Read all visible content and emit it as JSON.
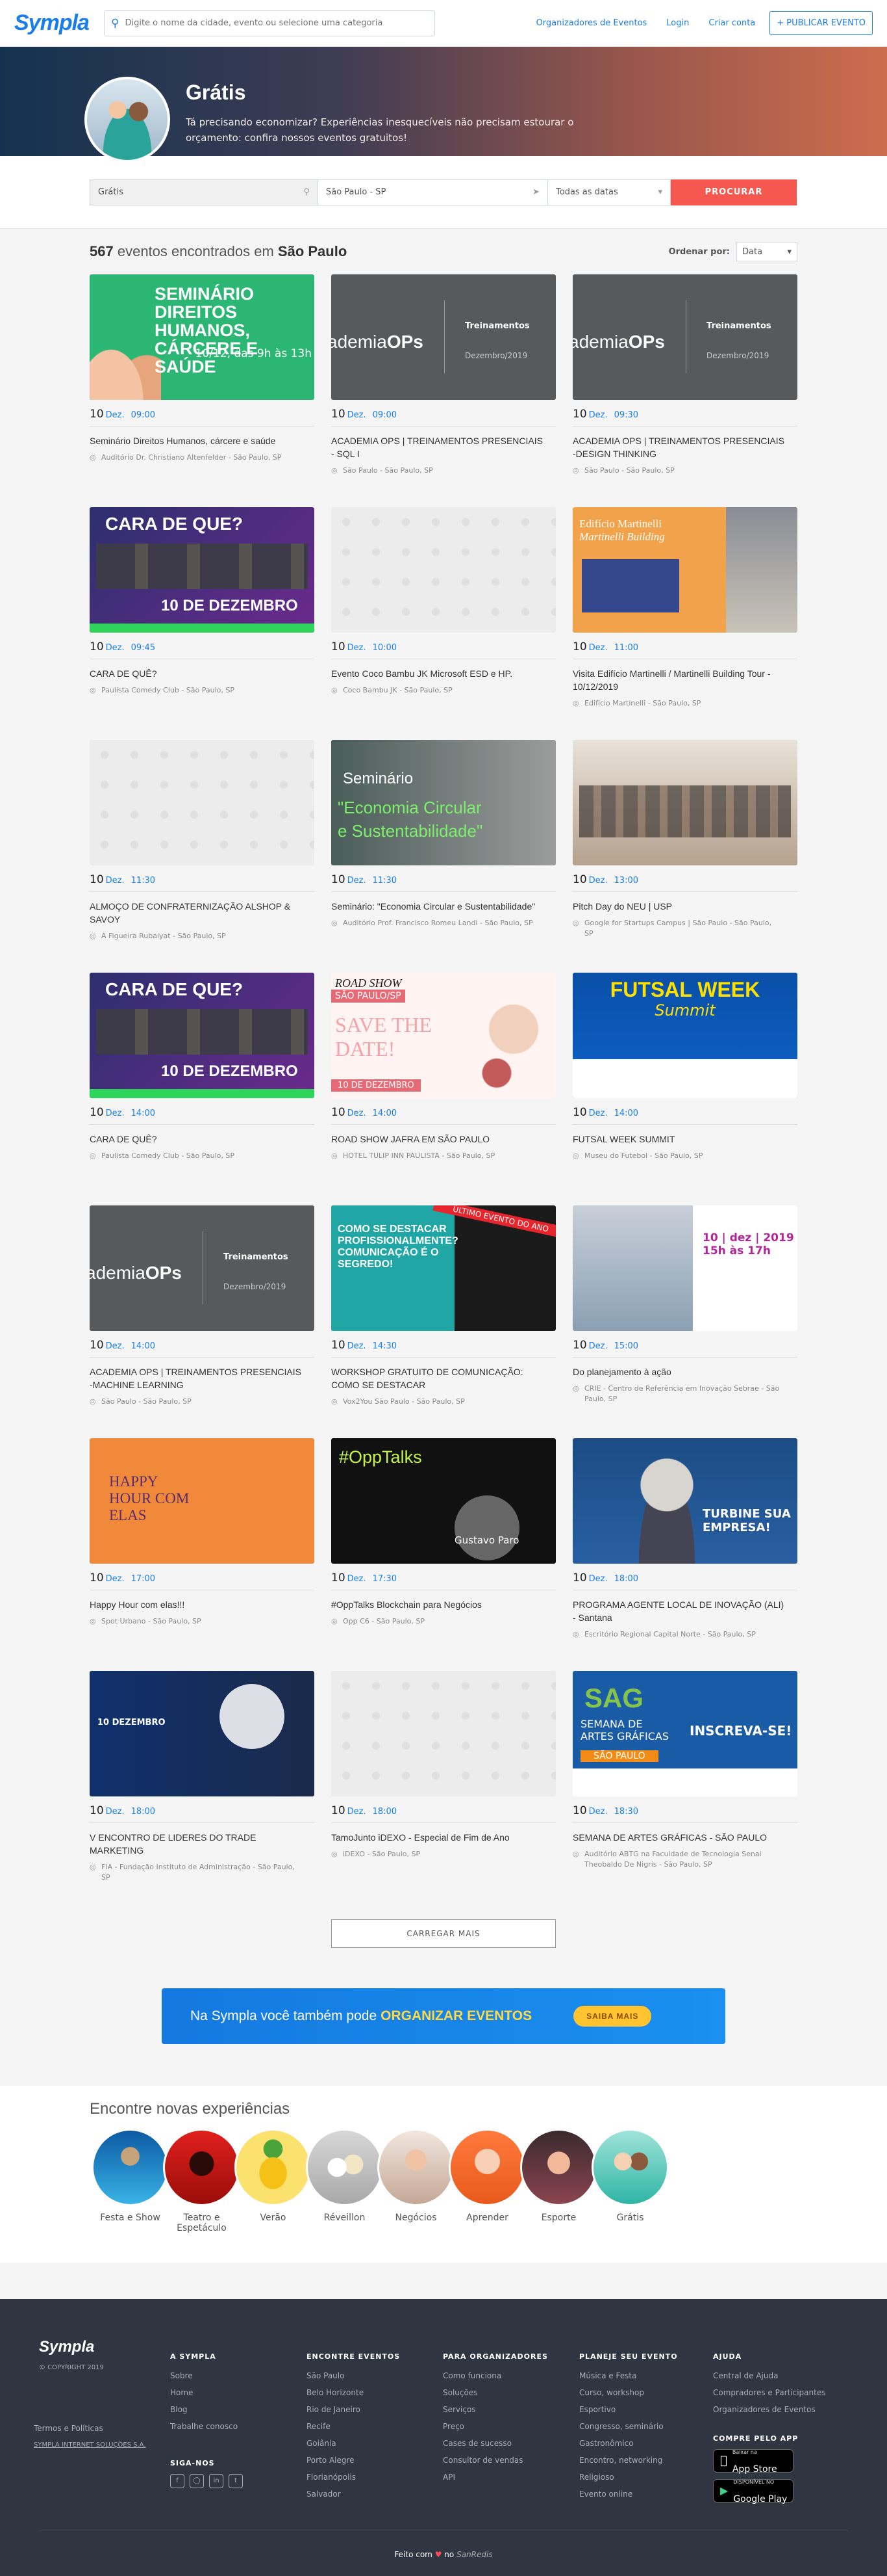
{
  "header": {
    "logo": "Sympla",
    "search_placeholder": "Digite o nome da cidade, evento ou selecione uma categoria",
    "nav": [
      "Organizadores de Eventos",
      "Login",
      "Criar conta"
    ],
    "publish": "+ PUBLICAR EVENTO"
  },
  "hero": {
    "title": "Grátis",
    "subtitle": "Tá precisando economizar? Experiências inesquecíveis não precisam estourar o orçamento: confira nossos eventos gratuitos!"
  },
  "filters": {
    "category": "Grátis",
    "city": "São Paulo - SP",
    "date": "Todas as datas",
    "search": "PROCURAR"
  },
  "results": {
    "count": "567",
    "text": "eventos encontrados em",
    "city": "São Paulo",
    "sort_label": "Ordenar por:",
    "sort_value": "Data"
  },
  "events": [
    {
      "day": "10",
      "month": "Dez.",
      "time": "09:00",
      "title": "Seminário Direitos Humanos, cárcere e saúde",
      "loc": "Auditório Dr. Christiano Altenfelder - São Paulo, SP",
      "img": "seminario"
    },
    {
      "day": "10",
      "month": "Dez.",
      "time": "09:00",
      "title": "ACADEMIA OPS | TREINAMENTOS PRESENCIAIS - SQL I",
      "loc": "São Paulo - São Paulo, SP",
      "img": "academia"
    },
    {
      "day": "10",
      "month": "Dez.",
      "time": "09:30",
      "title": "ACADEMIA OPS | TREINAMENTOS PRESENCIAIS -DESIGN THINKING",
      "loc": "São Paulo - São Paulo, SP",
      "img": "academia"
    },
    {
      "day": "10",
      "month": "Dez.",
      "time": "09:45",
      "title": "CARA DE QUÊ?",
      "loc": "Paulista Comedy Club - São Paulo, SP",
      "img": "cara"
    },
    {
      "day": "10",
      "month": "Dez.",
      "time": "10:00",
      "title": "Evento Coco Bambu JK Microsoft ESD e HP.",
      "loc": "Coco Bambu JK - São Paulo, SP",
      "img": "blank"
    },
    {
      "day": "10",
      "month": "Dez.",
      "time": "11:00",
      "title": "Visita Edifício Martinelli / Martinelli Building Tour - 10/12/2019",
      "loc": "Edifício Martinelli - São Paulo, SP",
      "img": "martinelli"
    },
    {
      "day": "10",
      "month": "Dez.",
      "time": "11:30",
      "title": "ALMOÇO DE CONFRATERNIZAÇÃO ALSHOP & SAVOY",
      "loc": "A Figueira Rubaiyat - São Paulo, SP",
      "img": "blank"
    },
    {
      "day": "10",
      "month": "Dez.",
      "time": "11:30",
      "title": "Seminário: \"Economia Circular e Sustentabilidade\"",
      "loc": "Auditório Prof. Francisco Romeu Landi - São Paulo, SP",
      "img": "economia"
    },
    {
      "day": "10",
      "month": "Dez.",
      "time": "13:00",
      "title": "Pitch Day do NEU | USP",
      "loc": "Google for Startups Campus | São Paulo - São Paulo, SP",
      "img": "pitch"
    },
    {
      "day": "10",
      "month": "Dez.",
      "time": "14:00",
      "title": "CARA DE QUÊ?",
      "loc": "Paulista Comedy Club - São Paulo, SP",
      "img": "cara"
    },
    {
      "day": "10",
      "month": "Dez.",
      "time": "14:00",
      "title": "ROAD SHOW JAFRA EM SÃO PAULO",
      "loc": "HOTEL TULIP INN PAULISTA - São Paulo, SP",
      "img": "roadshow"
    },
    {
      "day": "10",
      "month": "Dez.",
      "time": "14:00",
      "title": "FUTSAL WEEK SUMMIT",
      "loc": "Museu do Futebol - São Paulo, SP",
      "img": "futsal"
    },
    {
      "day": "10",
      "month": "Dez.",
      "time": "14:00",
      "title": "ACADEMIA OPS | TREINAMENTOS PRESENCIAIS -MACHINE LEARNING",
      "loc": "São Paulo - São Paulo, SP",
      "img": "academia"
    },
    {
      "day": "10",
      "month": "Dez.",
      "time": "14:30",
      "title": "WORKSHOP GRATUITO DE COMUNICAÇÃO: COMO SE DESTACAR",
      "loc": "Vox2You São Paulo - São Paulo, SP",
      "img": "workshop"
    },
    {
      "day": "10",
      "month": "Dez.",
      "time": "15:00",
      "title": "Do planejamento à ação",
      "loc": "CRIE - Centro de Referência em Inovação Sebrae - São Paulo, SP",
      "img": "planejamento"
    },
    {
      "day": "10",
      "month": "Dez.",
      "time": "17:00",
      "title": "Happy Hour com elas!!!",
      "loc": "Spot Urbano - São Paulo, SP",
      "img": "happy"
    },
    {
      "day": "10",
      "month": "Dez.",
      "time": "17:30",
      "title": "#OppTalks Blockchain para Negócios",
      "loc": "Opp C6 - São Paulo, SP",
      "img": "opptalks"
    },
    {
      "day": "10",
      "month": "Dez.",
      "time": "18:00",
      "title": "PROGRAMA AGENTE LOCAL DE INOVAÇÃO (ALI) - Santana",
      "loc": "Escritório Regional Capital Norte - São Paulo, SP",
      "img": "ali"
    },
    {
      "day": "10",
      "month": "Dez.",
      "time": "18:00",
      "title": "V ENCONTRO DE LIDERES DO TRADE MARKETING",
      "loc": "FIA - Fundação Instituto de Administração - São Paulo, SP",
      "img": "lideres"
    },
    {
      "day": "10",
      "month": "Dez.",
      "time": "18:00",
      "title": "TamoJunto iDEXO - Especial de Fim de Ano",
      "loc": "iDEXO - São Paulo, SP",
      "img": "blank"
    },
    {
      "day": "10",
      "month": "Dez.",
      "time": "18:30",
      "title": "SEMANA DE ARTES GRÁFICAS - SÃO PAULO",
      "loc": "Auditório ABTG na Faculdade de Tecnologia Senai Theobaldo De Nigris - São Paulo, SP",
      "img": "sag"
    }
  ],
  "load_more": "CARREGAR MAIS",
  "banner": {
    "text": "Na Sympla você também pode",
    "strong": "ORGANIZAR EVENTOS",
    "button": "SAIBA MAIS"
  },
  "experiences": {
    "title": "Encontre novas experiências",
    "items": [
      "Festa e Show",
      "Teatro e Espetáculo",
      "Verão",
      "Réveillon",
      "Negócios",
      "Aprender",
      "Esporte",
      "Grátis"
    ]
  },
  "footer": {
    "logo": "Sympla",
    "copyright": "© COPYRIGHT 2019",
    "terms": [
      "Termos e Políticas",
      "SYMPLA INTERNET SOLUÇÕES S.A."
    ],
    "cols": [
      {
        "title": "A SYMPLA",
        "items": [
          "Sobre",
          "Home",
          "Blog",
          "Trabalhe conosco"
        ]
      },
      {
        "title": "ENCONTRE EVENTOS",
        "items": [
          "São Paulo",
          "Belo Horizonte",
          "Rio de Janeiro",
          "Recife",
          "Goiânia",
          "Porto Alegre",
          "Florianópolis",
          "Salvador"
        ]
      },
      {
        "title": "PARA ORGANIZADORES",
        "items": [
          "Como funciona",
          "Soluções",
          "Serviços",
          "Preço",
          "Cases de sucesso",
          "Consultor de vendas",
          "API"
        ]
      },
      {
        "title": "PLANEJE SEU EVENTO",
        "items": [
          "Música e Festa",
          "Curso, workshop",
          "Esportivo",
          "Congresso, seminário",
          "Gastronômico",
          "Encontro, networking",
          "Religioso",
          "Evento online"
        ]
      },
      {
        "title": "AJUDA",
        "items": [
          "Central de Ajuda",
          "Compradores e Participantes",
          "Organizadores de Eventos"
        ]
      }
    ],
    "social_title": "SIGA-NOS",
    "app_title": "COMPRE PELO APP",
    "appstore": {
      "small": "Baixar na",
      "big": "App Store"
    },
    "googleplay": {
      "small": "DISPONÍVEL NO",
      "big": "Google Play"
    },
    "made": "Feito com",
    "made_by": "no",
    "city": "SanRedis"
  }
}
